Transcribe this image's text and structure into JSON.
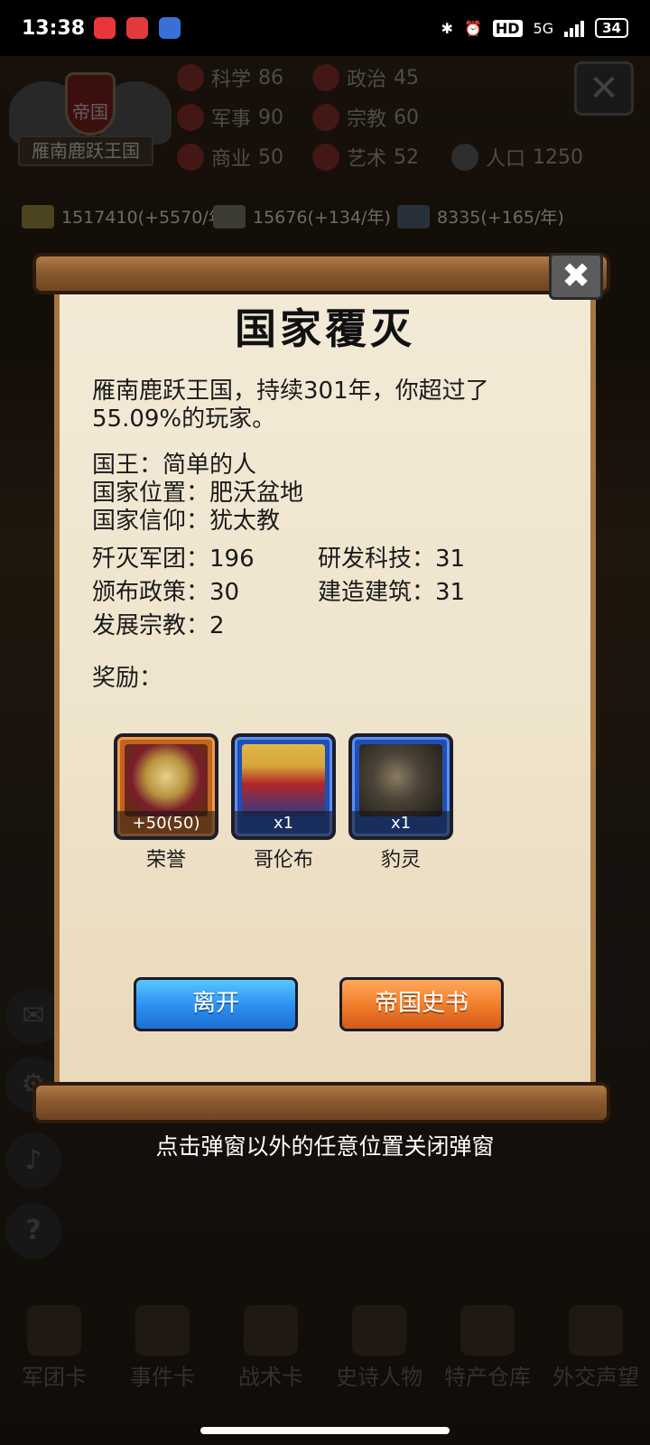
{
  "status_bar": {
    "time": "13:38",
    "network": "5G",
    "hd": "HD",
    "battery": "34"
  },
  "background": {
    "crest_title": "帝国",
    "kingdom_name": "雁南鹿跃王国",
    "stats": [
      {
        "label": "科学",
        "value": "86"
      },
      {
        "label": "政治",
        "value": "45"
      },
      {
        "label": "军事",
        "value": "90"
      },
      {
        "label": "宗教",
        "value": "60"
      },
      {
        "label": "商业",
        "value": "50"
      },
      {
        "label": "艺术",
        "value": "52"
      },
      {
        "label": "人口",
        "value": "1250"
      }
    ],
    "resources": [
      {
        "text": "1517410(+5570/年)"
      },
      {
        "text": "15676(+134/年)"
      },
      {
        "text": "8335(+165/年)"
      }
    ],
    "bottom_nav": [
      "军团卡",
      "事件卡",
      "战术卡",
      "史诗人物",
      "特产仓库",
      "外交声望"
    ]
  },
  "dialog": {
    "title": "国家覆灭",
    "summary": "雁南鹿跃王国，持续301年，你超过了55.09%的玩家。",
    "king": "国王：简单的人",
    "location": "国家位置：肥沃盆地",
    "religion": "国家信仰：犹太教",
    "stats": {
      "legions": "歼灭军团：196",
      "tech": "研发科技：31",
      "policies": "颁布政策：30",
      "buildings": "建造建筑：31",
      "religions": "发展宗教：2"
    },
    "reward_label": "奖励：",
    "rewards": [
      {
        "count": "+50(50)",
        "name": "荣誉"
      },
      {
        "count": "x1",
        "name": "哥伦布"
      },
      {
        "count": "x1",
        "name": "豹灵"
      }
    ],
    "leave_button": "离开",
    "history_button": "帝国史书",
    "close_glyph": "✖"
  },
  "hint": "点击弹窗以外的任意位置关闭弹窗"
}
